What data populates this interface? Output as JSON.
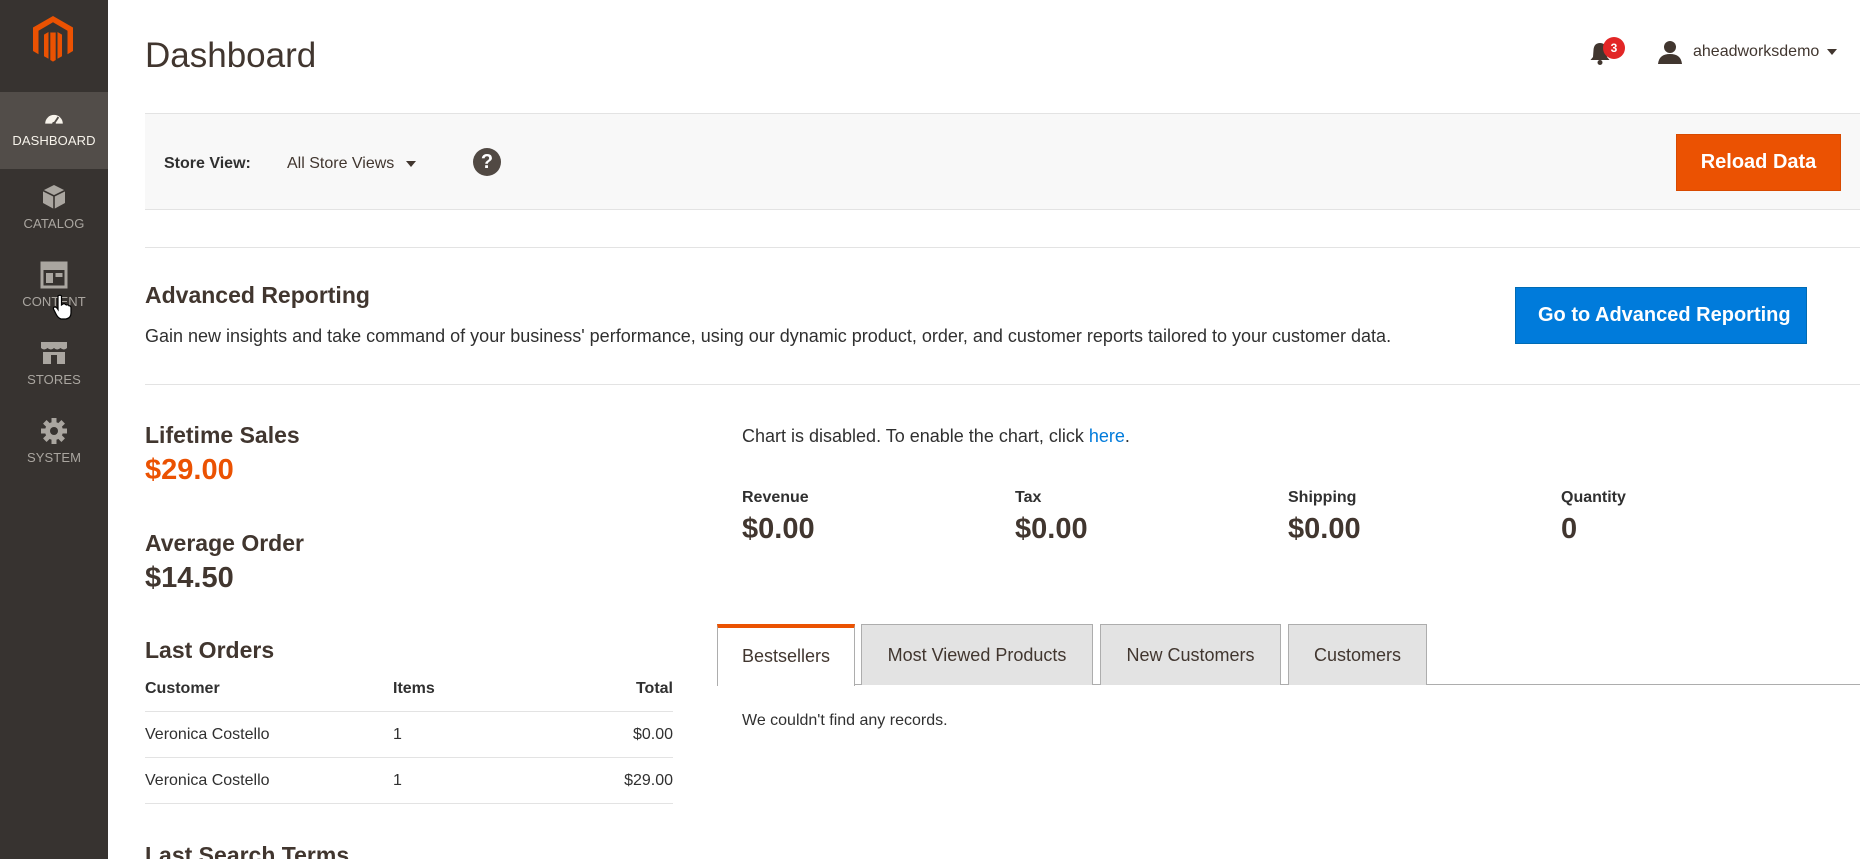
{
  "sidebar": {
    "logo": "magento-logo",
    "items": [
      {
        "label": "DASHBOARD",
        "icon": "speedometer-icon",
        "active": true
      },
      {
        "label": "CATALOG",
        "icon": "box-icon",
        "active": false
      },
      {
        "label": "CONTENT",
        "icon": "layout-icon",
        "active": false
      },
      {
        "label": "STORES",
        "icon": "storefront-icon",
        "active": false
      },
      {
        "label": "SYSTEM",
        "icon": "gear-icon",
        "active": false
      }
    ]
  },
  "header": {
    "title": "Dashboard",
    "notifications_count": "3",
    "username": "aheadworksdemo"
  },
  "store_bar": {
    "label": "Store View:",
    "selected": "All Store Views",
    "help": "?",
    "reload_label": "Reload Data"
  },
  "advanced_reporting": {
    "title": "Advanced Reporting",
    "text": "Gain new insights and take command of your business' performance, using our dynamic product, order, and customer reports tailored to your customer data.",
    "button_label": "Go to Advanced Reporting"
  },
  "stats": {
    "lifetime_sales_label": "Lifetime Sales",
    "lifetime_sales_value": "$29.00",
    "average_order_label": "Average Order",
    "average_order_value": "$14.50"
  },
  "last_orders": {
    "title": "Last Orders",
    "columns": [
      "Customer",
      "Items",
      "Total"
    ],
    "rows": [
      {
        "customer": "Veronica Costello",
        "items": "1",
        "total": "$0.00"
      },
      {
        "customer": "Veronica Costello",
        "items": "1",
        "total": "$29.00"
      }
    ]
  },
  "last_search_terms": {
    "title": "Last Search Terms"
  },
  "chart": {
    "message": "Chart is disabled. To enable the chart, click ",
    "link": "here",
    "suffix": "."
  },
  "kpis": {
    "revenue_label": "Revenue",
    "revenue_value": "$0.00",
    "tax_label": "Tax",
    "tax_value": "$0.00",
    "shipping_label": "Shipping",
    "shipping_value": "$0.00",
    "quantity_label": "Quantity",
    "quantity_value": "0"
  },
  "tabs": {
    "items": [
      "Bestsellers",
      "Most Viewed Products",
      "New Customers",
      "Customers"
    ],
    "active_index": 0,
    "empty_message": "We couldn't find any records."
  },
  "colors": {
    "accent": "#eb5202",
    "link": "#007bdb",
    "sidebar": "#373330"
  }
}
